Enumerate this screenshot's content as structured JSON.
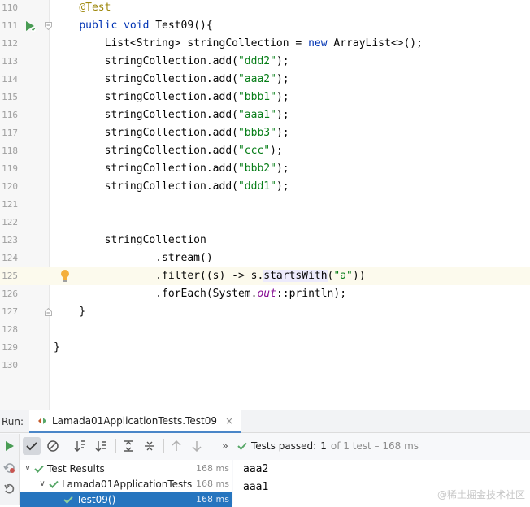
{
  "editor": {
    "lines": [
      {
        "num": "110",
        "segments": [
          {
            "t": "    "
          },
          {
            "t": "@Test",
            "c": "ann"
          }
        ]
      },
      {
        "num": "111",
        "segments": [
          {
            "t": "    "
          },
          {
            "t": "public void ",
            "c": "kw"
          },
          {
            "t": "Test09(){"
          }
        ]
      },
      {
        "num": "112",
        "segments": [
          {
            "t": "        List<String> stringCollection = "
          },
          {
            "t": "new ",
            "c": "kw"
          },
          {
            "t": "ArrayList<>();"
          }
        ]
      },
      {
        "num": "113",
        "segments": [
          {
            "t": "        stringCollection.add("
          },
          {
            "t": "\"ddd2\"",
            "c": "str"
          },
          {
            "t": ");"
          }
        ]
      },
      {
        "num": "114",
        "segments": [
          {
            "t": "        stringCollection.add("
          },
          {
            "t": "\"aaa2\"",
            "c": "str"
          },
          {
            "t": ");"
          }
        ]
      },
      {
        "num": "115",
        "segments": [
          {
            "t": "        stringCollection.add("
          },
          {
            "t": "\"bbb1\"",
            "c": "str"
          },
          {
            "t": ");"
          }
        ]
      },
      {
        "num": "116",
        "segments": [
          {
            "t": "        stringCollection.add("
          },
          {
            "t": "\"aaa1\"",
            "c": "str"
          },
          {
            "t": ");"
          }
        ]
      },
      {
        "num": "117",
        "segments": [
          {
            "t": "        stringCollection.add("
          },
          {
            "t": "\"bbb3\"",
            "c": "str"
          },
          {
            "t": ");"
          }
        ]
      },
      {
        "num": "118",
        "segments": [
          {
            "t": "        stringCollection.add("
          },
          {
            "t": "\"ccc\"",
            "c": "str"
          },
          {
            "t": ");"
          }
        ]
      },
      {
        "num": "119",
        "segments": [
          {
            "t": "        stringCollection.add("
          },
          {
            "t": "\"bbb2\"",
            "c": "str"
          },
          {
            "t": ");"
          }
        ]
      },
      {
        "num": "120",
        "segments": [
          {
            "t": "        stringCollection.add("
          },
          {
            "t": "\"ddd1\"",
            "c": "str"
          },
          {
            "t": ");"
          }
        ]
      },
      {
        "num": "121",
        "segments": []
      },
      {
        "num": "122",
        "segments": []
      },
      {
        "num": "123",
        "segments": [
          {
            "t": "        stringCollection"
          }
        ]
      },
      {
        "num": "124",
        "segments": [
          {
            "t": "                .stream()"
          }
        ]
      },
      {
        "num": "125",
        "segments": [
          {
            "t": "                .filter((s) -> s."
          },
          {
            "t": "startsWith",
            "c": "hl"
          },
          {
            "t": "("
          },
          {
            "t": "\"a\"",
            "c": "str"
          },
          {
            "t": "))"
          }
        ]
      },
      {
        "num": "126",
        "segments": [
          {
            "t": "                .forEach(System."
          },
          {
            "t": "out",
            "c": "stat"
          },
          {
            "t": "::println);"
          }
        ]
      },
      {
        "num": "127",
        "segments": [
          {
            "t": "    }"
          }
        ]
      },
      {
        "num": "128",
        "segments": []
      },
      {
        "num": "129",
        "segments": [
          {
            "t": "}"
          }
        ]
      },
      {
        "num": "130",
        "segments": []
      }
    ],
    "current_line": "125"
  },
  "run": {
    "label": "Run:",
    "tab_title": "Lamada01ApplicationTests.Test09",
    "close_glyph": "×",
    "expand_glyph": "»",
    "status": {
      "passed": "Tests passed:",
      "count": "1",
      "of": "of 1 test – 168 ms"
    },
    "tree": [
      {
        "label": "Test Results",
        "duration": "168 ms",
        "indent": 0,
        "expanded": true
      },
      {
        "label": "Lamada01ApplicationTests",
        "duration": "168 ms",
        "indent": 1,
        "expanded": true
      },
      {
        "label": "Test09()",
        "duration": "168 ms",
        "indent": 2,
        "expanded": false,
        "selected": true
      }
    ],
    "console": [
      "aaa2",
      "aaa1"
    ]
  },
  "watermark": "@稀土掘金技术社区",
  "colors": {
    "keyword": "#0033b3",
    "string": "#067d17",
    "annotation": "#9e880d",
    "pass_green": "#59a869",
    "run_green": "#499c54",
    "selection_blue": "#2675bf"
  }
}
